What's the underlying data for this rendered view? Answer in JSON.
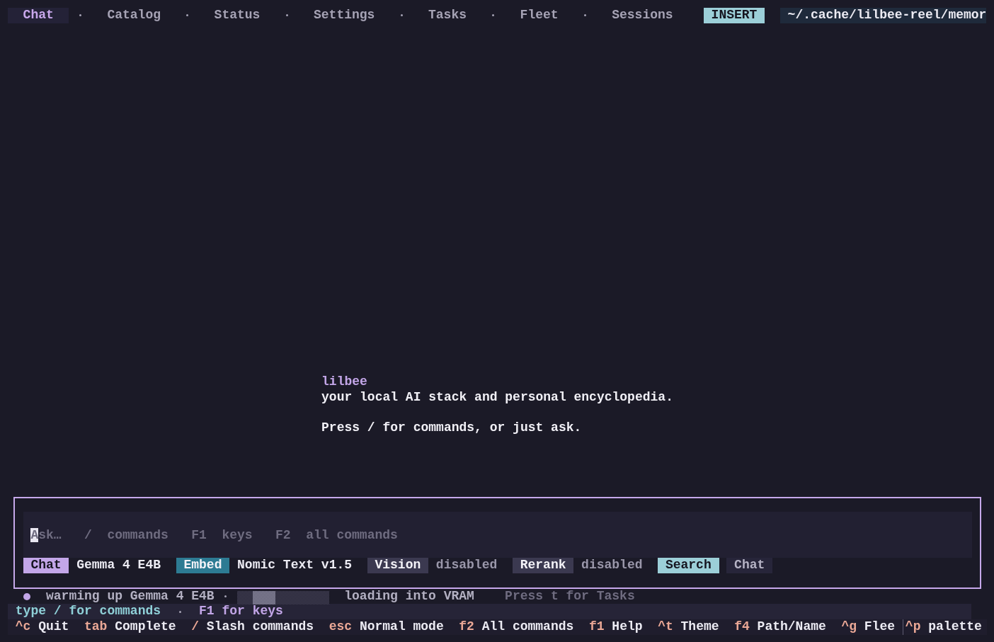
{
  "tabs": [
    {
      "label": "Chat",
      "selected": true
    },
    {
      "label": "Catalog",
      "selected": false
    },
    {
      "label": "Status",
      "selected": false
    },
    {
      "label": "Settings",
      "selected": false
    },
    {
      "label": "Tasks",
      "selected": false
    },
    {
      "label": "Fleet",
      "selected": false
    },
    {
      "label": "Sessions",
      "selected": false
    }
  ],
  "mode": "INSERT",
  "path": "~/.cache/lilbee-reel/memor",
  "welcome": {
    "title": "lilbee",
    "tagline": "your local AI stack and personal encyclopedia.",
    "hint": "Press / for commands, or just ask."
  },
  "prompt": {
    "placeholder": "Ask…   /  commands   F1  keys   F2  all commands"
  },
  "roles": [
    {
      "kind": "model",
      "label": "Chat",
      "value": "Gemma 4 E4B",
      "color": "#c3a6e8",
      "disabled": false
    },
    {
      "kind": "model",
      "label": "Embed",
      "value": "Nomic Text v1.5",
      "color": "#2d7b93",
      "disabled": false
    },
    {
      "kind": "model",
      "label": "Vision",
      "value": "disabled",
      "color": "#3b3950",
      "disabled": true
    },
    {
      "kind": "model",
      "label": "Rerank",
      "value": "disabled",
      "color": "#3b3950",
      "disabled": true
    },
    {
      "kind": "mode",
      "label": "Search",
      "value": "Chat",
      "color": "#9ccfd8",
      "disabled": false
    }
  ],
  "status": {
    "color": "#c3a6e8",
    "message": "warming up Gemma 4 E4B",
    "indeterminate": true,
    "detail": "loading into VRAM",
    "tip": "Press t for Tasks"
  },
  "hints": [
    {
      "text": "type / for commands",
      "color": "#8fd0d8"
    },
    {
      "text": "F1 for keys",
      "color": "#c3a6e8"
    }
  ],
  "bindings": [
    {
      "key": "^c",
      "action": "Quit"
    },
    {
      "key": "tab",
      "action": "Complete"
    },
    {
      "key": "/",
      "action": "Slash commands"
    },
    {
      "key": "esc",
      "action": "Normal mode"
    },
    {
      "key": "f2",
      "action": "All commands"
    },
    {
      "key": "f1",
      "action": "Help"
    },
    {
      "key": "^t",
      "action": "Theme"
    },
    {
      "key": "f4",
      "action": "Path/Name"
    },
    {
      "key": "^g",
      "action": "Flee"
    }
  ],
  "pinned_binding": {
    "key": "^p",
    "action": "palette"
  }
}
